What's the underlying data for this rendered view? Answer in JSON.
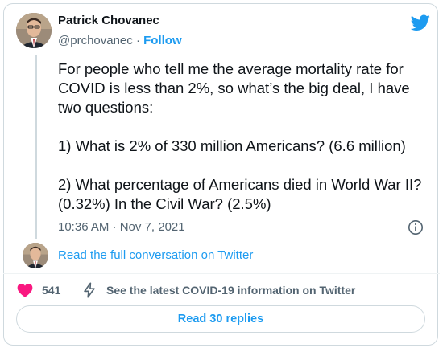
{
  "author": {
    "name": "Patrick Chovanec",
    "handle": "@prchovanec",
    "separator": "·",
    "follow_label": "Follow"
  },
  "tweet": {
    "paragraphs": [
      "For people who tell me the average mortality rate for COVID is less than 2%, so what’s the big deal, I have two questions:",
      "1) What is 2% of 330 million Americans? (6.6 million)",
      "2) What percentage of Americans died in World War II? (0.32%) In the Civil War? (2.5%)"
    ],
    "timestamp": "10:36 AM · Nov 7, 2021"
  },
  "conversation_link": "Read the full conversation on Twitter",
  "actions": {
    "like_count": "541",
    "covid_info": "See the latest COVID-19 information on Twitter",
    "replies_label": "Read 30 replies"
  },
  "colors": {
    "accent": "#1d9bf0",
    "heart": "#f91880",
    "text": "#0f1419",
    "muted": "#536471"
  },
  "icons": [
    "twitter-bird-icon",
    "info-icon",
    "heart-icon",
    "bolt-icon"
  ]
}
